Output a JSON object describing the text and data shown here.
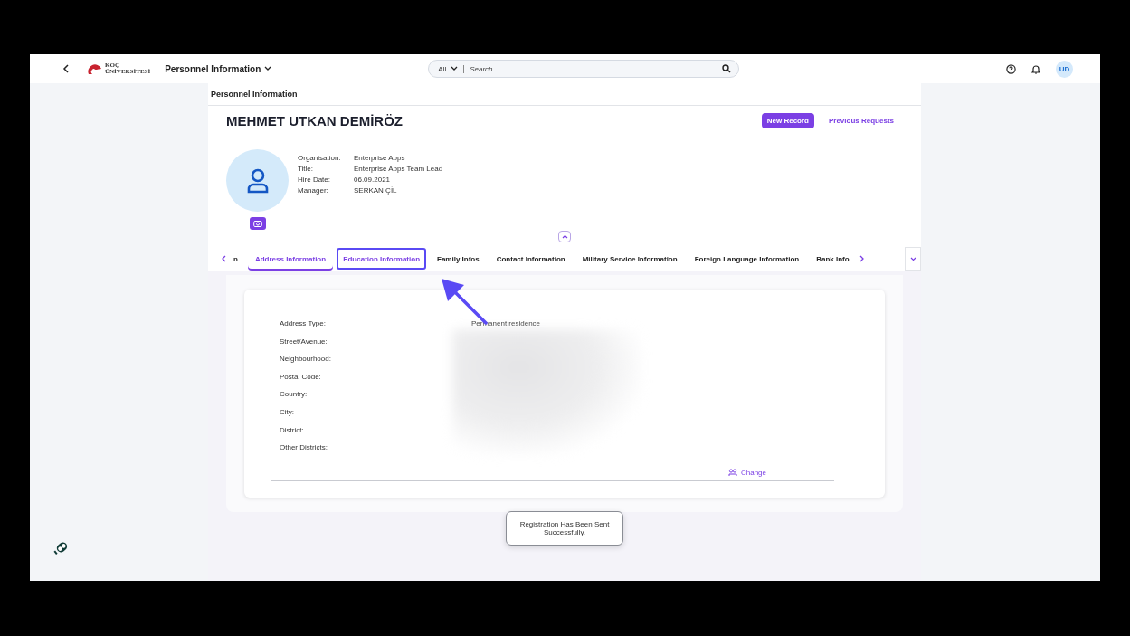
{
  "header": {
    "logo": [
      "KOÇ",
      "ÜNİVERSİTESİ"
    ],
    "app_title": "Personnel Information",
    "search_scope": "All",
    "search_placeholder": "Search",
    "user_initials": "UD"
  },
  "page_title": "Personnel Information",
  "employee_name": "MEHMET UTKAN DEMİRÖZ",
  "actions": [
    {
      "label": "New Record",
      "kind": "primary"
    },
    {
      "label": "Previous Requests",
      "kind": "link"
    }
  ],
  "details": [
    {
      "label": "Organisation:",
      "value": "Enterprise Apps"
    },
    {
      "label": "Title:",
      "value": "Enterprise Apps Team Lead"
    },
    {
      "label": "Hire Date:",
      "value": "06.09.2021"
    },
    {
      "label": "Manager:",
      "value": "SERKAN ÇİL"
    }
  ],
  "tabs": [
    {
      "label": "n",
      "selected": false,
      "highlighted": false
    },
    {
      "label": "Address Information",
      "selected": true,
      "highlighted": false
    },
    {
      "label": "Education Information",
      "selected": false,
      "highlighted": true
    },
    {
      "label": "Family Infos",
      "selected": false,
      "highlighted": false
    },
    {
      "label": "Contact Information",
      "selected": false,
      "highlighted": false
    },
    {
      "label": "Military Service Information",
      "selected": false,
      "highlighted": false
    },
    {
      "label": "Foreign Language Information",
      "selected": false,
      "highlighted": false
    },
    {
      "label": "Bank Info",
      "selected": false,
      "highlighted": false
    }
  ],
  "address_fields": [
    {
      "label": "Address Type:",
      "value": "Permanent residence"
    },
    {
      "label": "Street/Avenue:"
    },
    {
      "label": "Neighbourhood:"
    },
    {
      "label": "Postal Code:"
    },
    {
      "label": "Country:"
    },
    {
      "label": "City:"
    },
    {
      "label": "District:"
    },
    {
      "label": "Other Districts:"
    }
  ],
  "change_button": "Change",
  "toast": "Registration Has Been Sent Successfully."
}
